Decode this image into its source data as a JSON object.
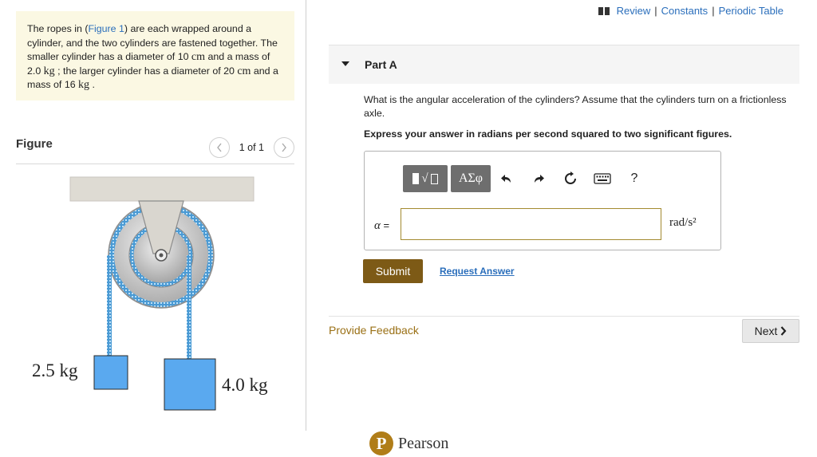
{
  "problem": {
    "t1": "The ropes in (",
    "figure_link": "Figure 1",
    "t2": ") are each wrapped around a cylinder, and the two cylinders are fastened together. The smaller cylinder has a diameter of 10 ",
    "u_cm1": "cm",
    "t3": " and a mass of 2.0 ",
    "u_kg1": "kg",
    "t4": " ; the larger cylinder has a diameter of 20 ",
    "u_cm2": "cm",
    "t5": " and a mass of 16 ",
    "u_kg2": "kg",
    "t6": " ."
  },
  "figure": {
    "title": "Figure",
    "pager": "1 of 1",
    "prev_icon": "chevron-left",
    "next_icon": "chevron-right",
    "mass_left": "2.5 kg",
    "mass_right": "4.0 kg"
  },
  "header_links": {
    "review": "Review",
    "sep": "|",
    "constants": "Constants",
    "periodic": "Periodic Table"
  },
  "part": {
    "title": "Part A"
  },
  "question": "What is the angular acceleration of the cylinders? Assume that the cylinders turn on a frictionless axle.",
  "instruction": "Express your answer in radians per second squared to two significant figures.",
  "toolbar": {
    "greek": "ΑΣφ",
    "help": "?"
  },
  "answer": {
    "label": "α",
    "equals": " =",
    "value": "",
    "unit": "rad/s²"
  },
  "buttons": {
    "submit": "Submit",
    "request": "Request Answer",
    "feedback": "Provide Feedback",
    "next": "Next"
  },
  "brand": {
    "logo_letter": "P",
    "name": "Pearson"
  },
  "colors": {
    "link": "#2a6ebb",
    "submit": "#7d5a16",
    "feedback": "#9a7015",
    "problem_bg": "#fbf8e3",
    "mass_fill": "#5aa9ef",
    "rope": "#4a9ad4"
  }
}
